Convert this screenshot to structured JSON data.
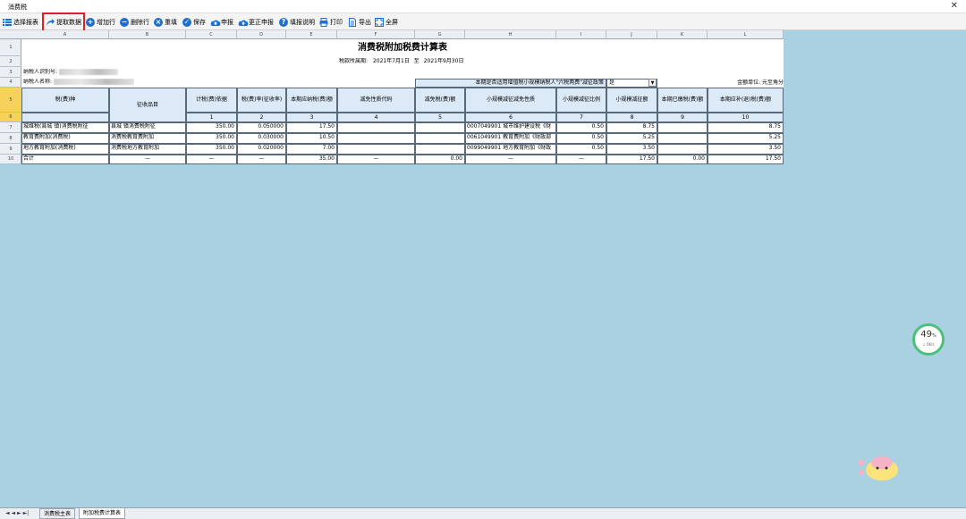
{
  "window": {
    "title": "消费税"
  },
  "toolbar": {
    "select_report": "选择报表",
    "fetch_data": "提取数据",
    "add_row": "增加行",
    "delete_row": "删除行",
    "refill": "重填",
    "save": "保存",
    "declare": "申报",
    "correct_declare": "更正申报",
    "help": "填报说明",
    "print": "打印",
    "export": "导出",
    "fullscreen": "全屏"
  },
  "columns": [
    "A",
    "B",
    "C",
    "D",
    "E",
    "F",
    "G",
    "H",
    "I",
    "J",
    "K",
    "L"
  ],
  "rows": [
    "1",
    "2",
    "3",
    "4",
    "5",
    "6",
    "7",
    "8",
    "9",
    "10"
  ],
  "form": {
    "title": "消费税附加税费计算表",
    "period_label": "税款所属期:",
    "period_start": "2021年7月1日",
    "period_sep": "至",
    "period_end": "2021年9月30日",
    "taxpayer_id_label": "纳税人识别号:",
    "taxpayer_name_label": "纳税人名称:",
    "policy_question": "本期是否适用增值税小规模纳税人\"六税两费\"减征政策",
    "policy_answer": "是",
    "unit_label": "金额单位: 元至角分"
  },
  "headers": {
    "tax_type": "税(费)种",
    "item": "征收品目",
    "basis": "计税(费)依据",
    "rate": "税(费)率(征收率)",
    "payable": "本期应纳税(费)额",
    "exempt_code": "减免性质代码",
    "exempt_amount": "减免税(费)额",
    "small_code": "小规模减征减免性质",
    "small_ratio": "小规模减征比例",
    "small_amount": "小规模减征额",
    "paid": "本期已缴税(费)额",
    "refund": "本期应补(退)税(费)额",
    "idx": [
      "1",
      "2",
      "3",
      "4",
      "5",
      "6",
      "7",
      "8",
      "9",
      "10"
    ]
  },
  "table_rows": [
    {
      "tax_type": "城维税(县城 镇)消费税附征",
      "item": "县城 镇消费税附征",
      "basis": "350.00",
      "rate": "0.050000",
      "payable": "17.50",
      "exempt_code": "",
      "exempt_amount": "",
      "small_code": "0007049901 城市维护建设税《财",
      "small_ratio": "0.50",
      "small_amount": "8.75",
      "paid": "",
      "refund": "8.75"
    },
    {
      "tax_type": "教育费附加(消费税)",
      "item": "消费税教育费附加",
      "basis": "350.00",
      "rate": "0.030000",
      "payable": "10.50",
      "exempt_code": "",
      "exempt_amount": "",
      "small_code": "0061049901 教育费附加《财政部",
      "small_ratio": "0.50",
      "small_amount": "5.25",
      "paid": "",
      "refund": "5.25"
    },
    {
      "tax_type": "地方教育附加(消费税)",
      "item": "消费税地方教育附加",
      "basis": "350.00",
      "rate": "0.020000",
      "payable": "7.00",
      "exempt_code": "",
      "exempt_amount": "",
      "small_code": "0099049901 地方教育附加《财政",
      "small_ratio": "0.50",
      "small_amount": "3.50",
      "paid": "",
      "refund": "3.50"
    }
  ],
  "total_row": {
    "label": "合计",
    "item": "—",
    "basis": "—",
    "rate": "—",
    "payable": "35.00",
    "exempt_code": "—",
    "exempt_amount": "0.00",
    "small_code": "—",
    "small_ratio": "—",
    "small_amount": "17.50",
    "paid": "0.00",
    "refund": "17.50"
  },
  "sheet_tabs": [
    "消费税主表",
    "附加税费计算表"
  ],
  "nav_arrows": "◄ ◄ ► ►|",
  "gauge": {
    "percent": "49",
    "pct_sign": "%",
    "speed": "↓ 0K/s"
  }
}
